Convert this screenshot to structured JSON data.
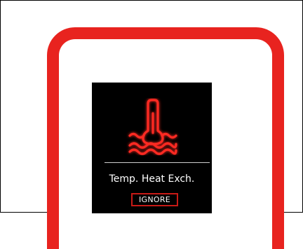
{
  "colors": {
    "bezel": "#e8231f",
    "screen_background": "#000000",
    "warning_icon": "#ff2a22",
    "button_border": "#c81a16",
    "text": "#ffffff"
  },
  "display": {
    "warning_icon": "coolant-temperature-warning-icon",
    "message": "Temp. Heat Exch.",
    "ignore_label": "IGNORE"
  }
}
